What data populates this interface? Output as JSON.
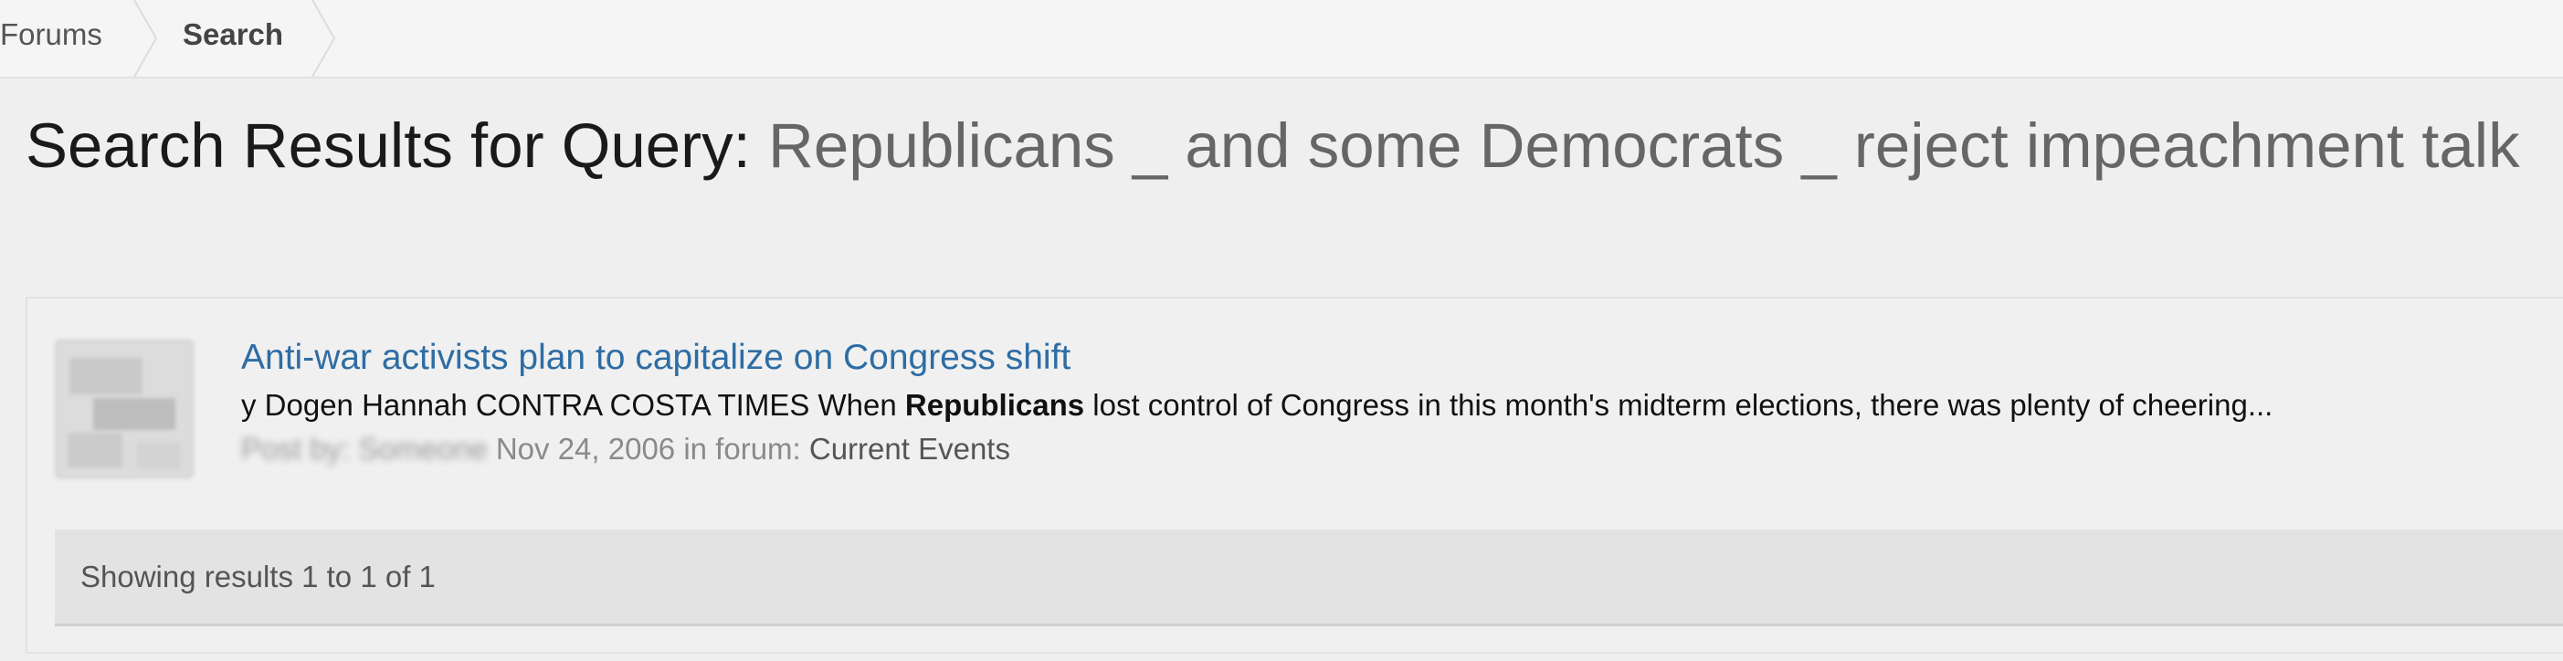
{
  "breadcrumb": {
    "items": [
      {
        "label": "Forums"
      },
      {
        "label": "Search"
      }
    ]
  },
  "title": {
    "prefix": "Search Results for Query:",
    "query": "Republicans _ and some Democrats _ reject impeachment talk"
  },
  "results": [
    {
      "title": "Anti-war activists plan to capitalize on Congress shift",
      "snippet_before": "y Dogen Hannah CONTRA COSTA TIMES When ",
      "snippet_highlight": "Republicans",
      "snippet_after": " lost control of Congress in this month's midterm elections, there was plenty of cheering...",
      "post_by_label": "Post by:",
      "author": "Someone",
      "date": "Nov 24, 2006",
      "forum_prefix": " in forum: ",
      "forum": "Current Events"
    }
  ],
  "pager": {
    "text": "Showing results 1 to 1 of 1"
  },
  "colors": {
    "link": "#2e6da4",
    "query": "#666666",
    "meta": "#8a8a8a"
  }
}
